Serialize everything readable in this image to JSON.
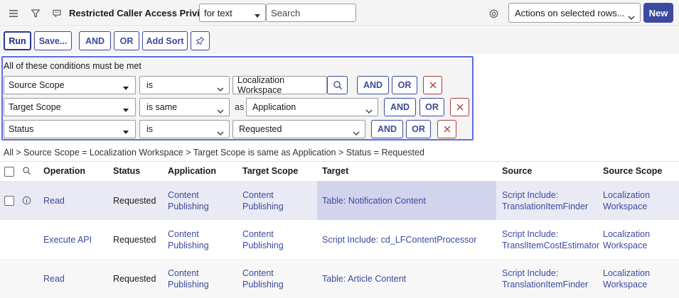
{
  "header": {
    "title": "Restricted Caller Access Privileges",
    "search_field": "for text",
    "search_placeholder": "Search",
    "actions_select": "Actions on selected rows...",
    "new_label": "New"
  },
  "toolbar": {
    "run": "Run",
    "save": "Save...",
    "and": "AND",
    "or": "OR",
    "add_sort": "Add Sort"
  },
  "conditions": {
    "label": "All of these conditions must be met",
    "rows": [
      {
        "field": "Source Scope",
        "operator": "is",
        "value": "Localization Workspace",
        "and": "AND",
        "or": "OR"
      },
      {
        "field": "Target Scope",
        "operator": "is same",
        "as": "as",
        "value": "Application",
        "and": "AND",
        "or": "OR"
      },
      {
        "field": "Status",
        "operator": "is",
        "value": "Requested",
        "and": "AND",
        "or": "OR"
      }
    ]
  },
  "breadcrumb": "All > Source Scope = Localization Workspace > Target Scope is same as Application > Status = Requested",
  "table": {
    "columns": [
      "Operation",
      "Status",
      "Application",
      "Target Scope",
      "Target",
      "Source",
      "Source Scope"
    ],
    "rows": [
      {
        "operation": "Read",
        "status": "Requested",
        "application_1": "Content",
        "application_2": "Publishing",
        "target_scope_1": "Content",
        "target_scope_2": "Publishing",
        "target": "Table: Notification Content",
        "source_1": "Script Include:",
        "source_2": "TranslationItemFinder",
        "source_scope_1": "Localization",
        "source_scope_2": "Workspace"
      },
      {
        "operation": "Execute API",
        "status": "Requested",
        "application_1": "Content",
        "application_2": "Publishing",
        "target_scope_1": "Content",
        "target_scope_2": "Publishing",
        "target": "Script Include: cd_LFContentProcessor",
        "source_1": "Script Include:",
        "source_2": "TranslItemCostEstimator",
        "source_scope_1": "Localization",
        "source_scope_2": "Workspace"
      },
      {
        "operation": "Read",
        "status": "Requested",
        "application_1": "Content",
        "application_2": "Publishing",
        "target_scope_1": "Content",
        "target_scope_2": "Publishing",
        "target": "Table: Article Content",
        "source_1": "Script Include:",
        "source_2": "TranslationItemFinder",
        "source_scope_1": "Localization",
        "source_scope_2": "Workspace"
      }
    ]
  },
  "colors": {
    "accent": "#3b4a9f",
    "condition_border": "#5b6fde",
    "remove": "#b03a3a",
    "row_highlight": "#eaeaf4"
  }
}
